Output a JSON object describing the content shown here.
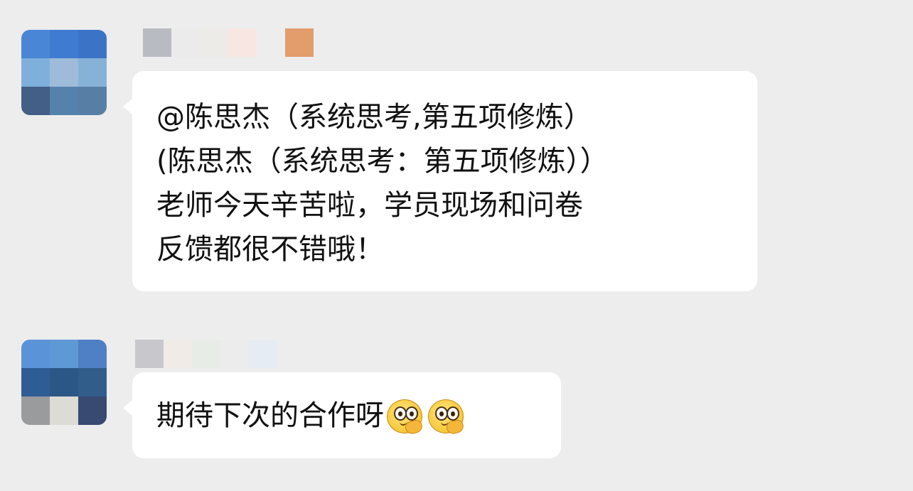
{
  "messages": [
    {
      "avatar_colors": [
        "#4a86d6",
        "#3f7bd0",
        "#3b74c6",
        "#7fb0dc",
        "#9ebcd9",
        "#86b2d8",
        "#435f86",
        "#5582ad",
        "#577fa6"
      ],
      "name_blur_colors": [
        "#b8bbc2",
        "#ebebeb",
        "#ecebe8",
        "#f8e6e3",
        "#ededed",
        "#e39c6c"
      ],
      "lines": [
        "@陈思杰（系统思考,第五项修炼）",
        "(陈思杰（系统思考：第五项修炼））",
        "老师今天辛苦啦，学员现场和问卷",
        "反馈都很不错哦！"
      ]
    },
    {
      "avatar_colors": [
        "#5b93d8",
        "#5e99d6",
        "#4f7fc4",
        "#2d5d94",
        "#2a5786",
        "#315d8b",
        "#9a9b9d",
        "#dcdbd6",
        "#394a72"
      ],
      "name_blur_colors": [
        "#c8c8cc",
        "#f0ebe6",
        "#e8ece6",
        "#ececec",
        "#e6ecf4",
        "#ededed"
      ],
      "text": "期待下次的合作呀",
      "emojis": [
        "hand-over-mouth-face-emoji",
        "hand-over-mouth-face-emoji"
      ]
    }
  ]
}
